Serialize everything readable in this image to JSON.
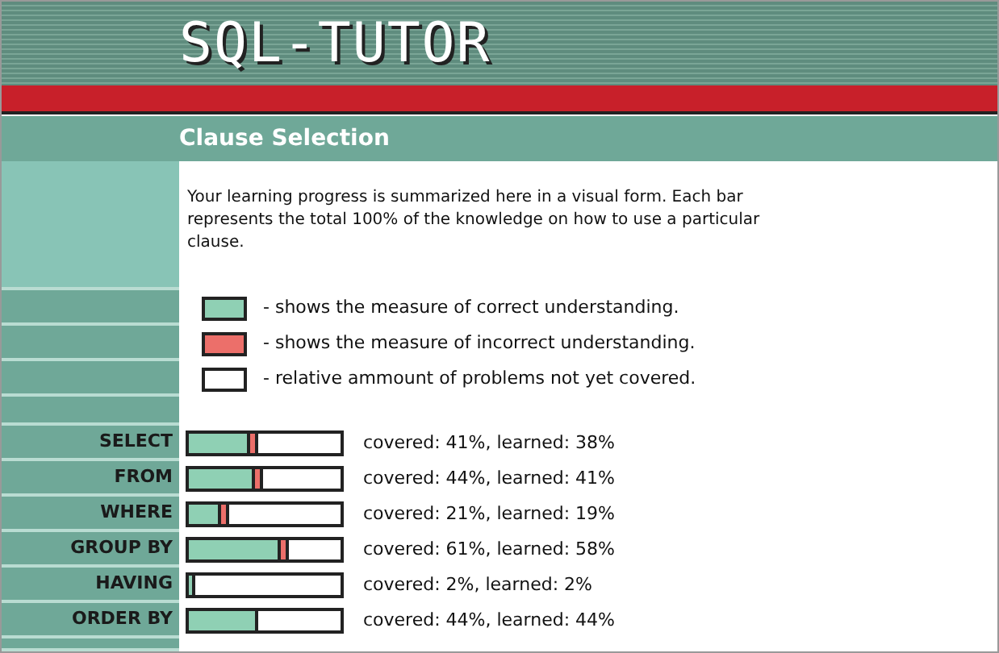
{
  "header": {
    "title": "SQL-TUTOR"
  },
  "section": {
    "title": "Clause Selection"
  },
  "intro": "Your learning progress is summarized here in a visual form. Each bar represents the total 100% of the knowledge on how to use a particular clause.",
  "legend": [
    {
      "kind": "correct",
      "text": "- shows the measure of correct understanding."
    },
    {
      "kind": "incorrect",
      "text": "- shows the measure of incorrect understanding."
    },
    {
      "kind": "uncovered",
      "text": "- relative ammount of problems not yet covered."
    }
  ],
  "clauses": [
    {
      "name": "SELECT",
      "correct": {
        "level": 0.38
      },
      "incorrect": true,
      "reading": "covered: 41%, learned: 38%"
    },
    {
      "name": "FROM",
      "correct": {
        "level": 0.41
      },
      "incorrect": true,
      "reading": "covered: 44%, learned: 41%"
    },
    {
      "name": "WHERE",
      "correct": {
        "level": 0.19
      },
      "incorrect": true,
      "reading": "covered: 21%, learned: 19%"
    },
    {
      "name": "GROUP BY",
      "correct": {
        "level": 0.58
      },
      "incorrect": true,
      "reading": "covered: 61%, learned: 58%"
    },
    {
      "name": "HAVING",
      "correct": {
        "level": 0.02
      },
      "incorrect": false,
      "reading": "covered: 2%, learned: 2%"
    },
    {
      "name": "ORDER BY",
      "correct": {
        "level": 0.44
      },
      "incorrect": false,
      "reading": "covered: 44%, learned: 44%"
    }
  ]
}
